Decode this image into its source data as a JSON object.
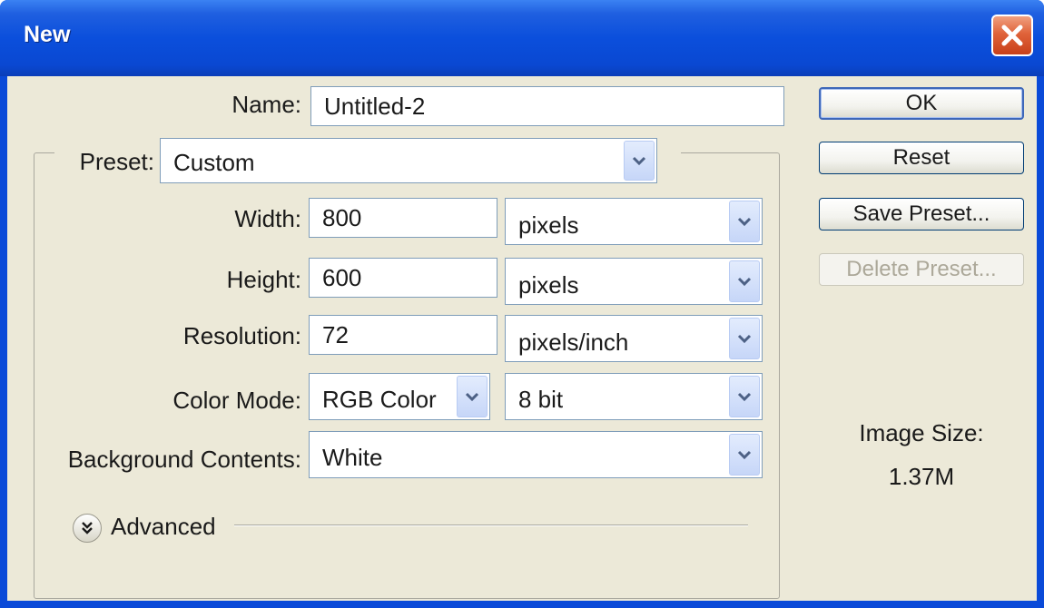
{
  "window": {
    "title": "New"
  },
  "form": {
    "name_label": "Name:",
    "name_value": "Untitled-2",
    "preset_label": "Preset:",
    "preset_value": "Custom",
    "width_label": "Width:",
    "width_value": "800",
    "width_unit": "pixels",
    "height_label": "Height:",
    "height_value": "600",
    "height_unit": "pixels",
    "resolution_label": "Resolution:",
    "resolution_value": "72",
    "resolution_unit": "pixels/inch",
    "color_mode_label": "Color Mode:",
    "color_mode_value": "RGB Color",
    "bit_depth_value": "8 bit",
    "background_label": "Background Contents:",
    "background_value": "White",
    "advanced_label": "Advanced"
  },
  "buttons": {
    "ok": "OK",
    "reset": "Reset",
    "save_preset": "Save Preset...",
    "delete_preset": "Delete Preset..."
  },
  "image_size": {
    "label": "Image Size:",
    "value": "1.37M"
  },
  "colors": {
    "titlebar": "#0a4ad8",
    "client": "#ece9d8",
    "close": "#e0633a",
    "field_border": "#7f9db9"
  },
  "icons": [
    "close-icon",
    "chevron-down-icon",
    "double-chevron-down-icon"
  ]
}
